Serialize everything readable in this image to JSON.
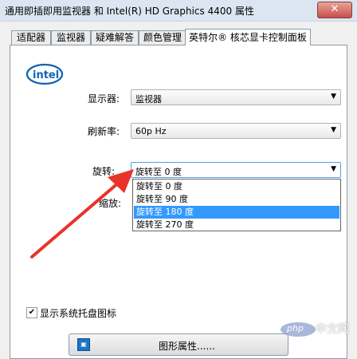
{
  "window": {
    "title": "通用即插即用监视器 和 Intel(R) HD Graphics 4400 属性",
    "close_label": "✕"
  },
  "tabs": [
    {
      "label": "适配器"
    },
    {
      "label": "监视器"
    },
    {
      "label": "疑难解答"
    },
    {
      "label": "颜色管理"
    },
    {
      "label": "英特尔® 核芯显卡控制面板",
      "active": true
    }
  ],
  "panel": {
    "logo_text": "intel",
    "display": {
      "label": "显示器:",
      "value": "监视器"
    },
    "refresh": {
      "label": "刷新率:",
      "value": "60p Hz"
    },
    "rotation": {
      "label": "旋转:",
      "value": "旋转至 0 度",
      "options": [
        "旋转至 0 度",
        "旋转至 90 度",
        "旋转至 180 度",
        "旋转至 270 度"
      ],
      "selected_index": 2
    },
    "scale": {
      "label": "缩放:"
    },
    "tray_checkbox": {
      "label": "显示系统托盘图标",
      "checked": true
    },
    "graphics_button": {
      "label": "图形属性......"
    }
  },
  "annotation": {
    "arrow_color": "#e8332a"
  },
  "watermark": {
    "text": "中文网",
    "logo": "php"
  },
  "colors": {
    "selection": "#3399ff",
    "titlebar": "#dbe6f2",
    "close": "#c75050"
  }
}
